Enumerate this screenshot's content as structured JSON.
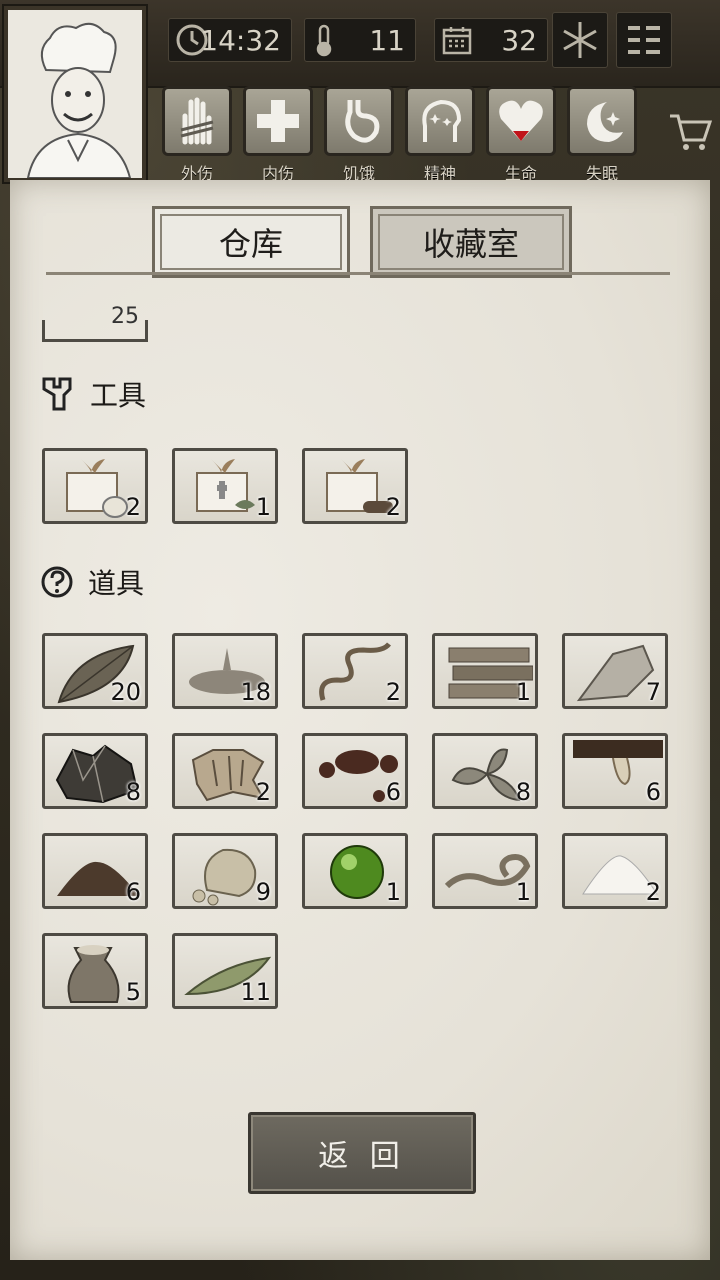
{
  "status_bar": {
    "time": "14:32",
    "temperature": "11",
    "day": "32"
  },
  "conditions": [
    {
      "id": "external-injury",
      "label": "外伤"
    },
    {
      "id": "internal-injury",
      "label": "内伤"
    },
    {
      "id": "hunger",
      "label": "饥饿"
    },
    {
      "id": "spirit",
      "label": "精神"
    },
    {
      "id": "life",
      "label": "生命"
    },
    {
      "id": "insomnia",
      "label": "失眠"
    }
  ],
  "tabs": {
    "warehouse": "仓库",
    "collection": "收藏室"
  },
  "partial_item": {
    "qty": "25"
  },
  "sections": {
    "tools": {
      "title": "工具",
      "items": [
        {
          "name": "cooking-kit",
          "qty": "2"
        },
        {
          "name": "medical-kit",
          "qty": "1"
        },
        {
          "name": "woodwork-kit",
          "qty": "2"
        }
      ]
    },
    "props": {
      "title": "道具",
      "items": [
        {
          "name": "leaf",
          "qty": "20"
        },
        {
          "name": "water-puddle",
          "qty": "18"
        },
        {
          "name": "vine",
          "qty": "2"
        },
        {
          "name": "wood-planks",
          "qty": "1"
        },
        {
          "name": "stone",
          "qty": "7"
        },
        {
          "name": "ore",
          "qty": "8"
        },
        {
          "name": "animal-hide",
          "qty": "2"
        },
        {
          "name": "blood",
          "qty": "6"
        },
        {
          "name": "herb",
          "qty": "8"
        },
        {
          "name": "sap",
          "qty": "6"
        },
        {
          "name": "soil",
          "qty": "6"
        },
        {
          "name": "rock",
          "qty": "9"
        },
        {
          "name": "green-orb",
          "qty": "1"
        },
        {
          "name": "rope",
          "qty": "1"
        },
        {
          "name": "salt",
          "qty": "2"
        },
        {
          "name": "grain-sack",
          "qty": "5"
        },
        {
          "name": "long-leaf",
          "qty": "11"
        }
      ]
    }
  },
  "back_button": "返 回",
  "colors": {
    "paper": "#e6e2d8",
    "frame": "#2e2a22",
    "slot_border": "#4e4b44"
  }
}
